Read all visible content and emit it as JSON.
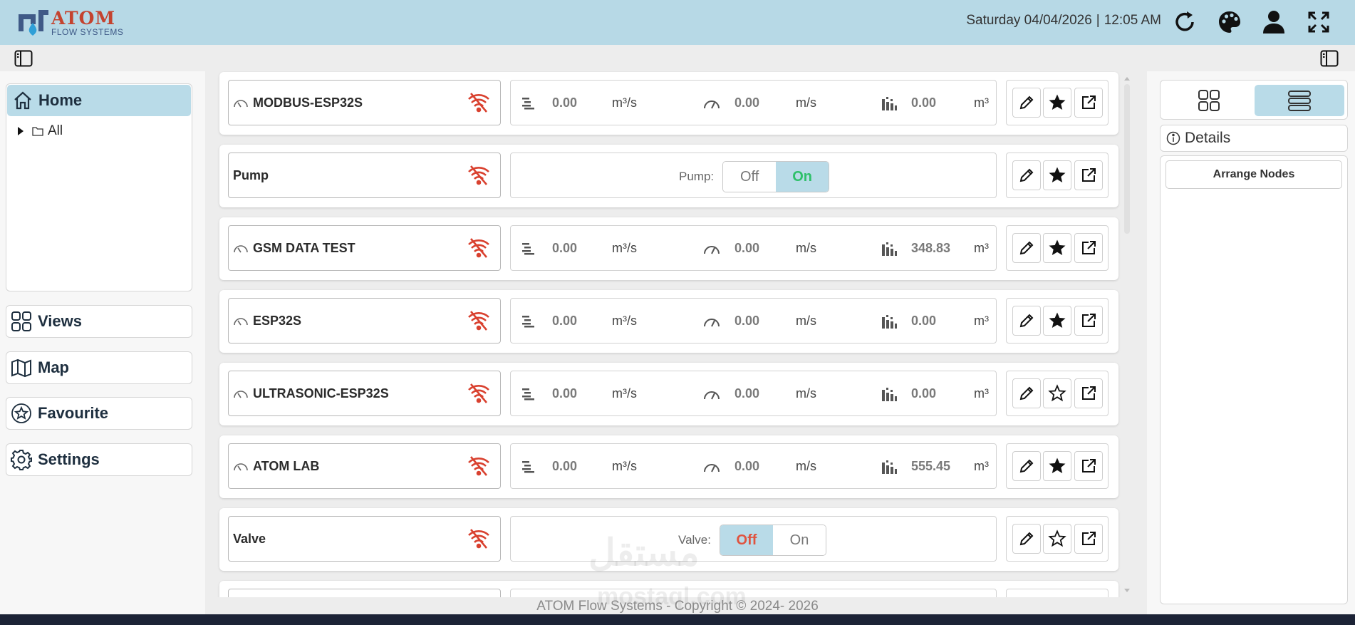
{
  "header": {
    "brand_title": "ATOM",
    "brand_subtitle": "FLOW SYSTEMS",
    "date": "Saturday 04/04/2026",
    "separator": "|",
    "time": "12:05 AM",
    "icons": [
      "refresh-icon",
      "palette-icon",
      "user-icon",
      "fullscreen-icon"
    ]
  },
  "sidebar": {
    "home_label": "Home",
    "tree_root": "All",
    "nav": [
      {
        "label": "Views",
        "icon": "views-grid-icon"
      },
      {
        "label": "Map",
        "icon": "map-icon"
      },
      {
        "label": "Favourite",
        "icon": "star-circle-icon"
      },
      {
        "label": "Settings",
        "icon": "gear-icon"
      }
    ]
  },
  "devices": [
    {
      "name": "MODBUS-ESP32S",
      "type": "meter",
      "gauge_icon": true,
      "flow": "0.00",
      "flow_unit": "m³/s",
      "velocity": "0.00",
      "velocity_unit": "m/s",
      "total": "0.00",
      "total_unit": "m³",
      "favourite": true
    },
    {
      "name": "Pump",
      "type": "toggle",
      "gauge_icon": false,
      "toggle_label": "Pump:",
      "off_label": "Off",
      "on_label": "On",
      "state": "on",
      "favourite": true
    },
    {
      "name": "GSM DATA TEST",
      "type": "meter",
      "gauge_icon": true,
      "flow": "0.00",
      "flow_unit": "m³/s",
      "velocity": "0.00",
      "velocity_unit": "m/s",
      "total": "348.83",
      "total_unit": "m³",
      "favourite": true
    },
    {
      "name": "ESP32S",
      "type": "meter",
      "gauge_icon": true,
      "flow": "0.00",
      "flow_unit": "m³/s",
      "velocity": "0.00",
      "velocity_unit": "m/s",
      "total": "0.00",
      "total_unit": "m³",
      "favourite": true
    },
    {
      "name": "ULTRASONIC-ESP32S",
      "type": "meter",
      "gauge_icon": true,
      "flow": "0.00",
      "flow_unit": "m³/s",
      "velocity": "0.00",
      "velocity_unit": "m/s",
      "total": "0.00",
      "total_unit": "m³",
      "favourite": false
    },
    {
      "name": "ATOM LAB",
      "type": "meter",
      "gauge_icon": true,
      "flow": "0.00",
      "flow_unit": "m³/s",
      "velocity": "0.00",
      "velocity_unit": "m/s",
      "total": "555.45",
      "total_unit": "m³",
      "favourite": true
    },
    {
      "name": "Valve",
      "type": "toggle",
      "gauge_icon": false,
      "toggle_label": "Valve:",
      "off_label": "Off",
      "on_label": "On",
      "state": "off",
      "favourite": false
    }
  ],
  "right_panel": {
    "details_label": "Details",
    "arrange_label": "Arrange Nodes",
    "active_view": "list"
  },
  "footer": {
    "copyright": "ATOM Flow Systems - Copyright © 2024- 2026",
    "watermark_ar": "مستقل",
    "watermark_en": "mostaql.com"
  },
  "colors": {
    "header_bg": "#b7d9e6",
    "accent": "#b9dbe8",
    "wifi_off": "#d9412f",
    "on_green": "#2ec06a",
    "off_red": "#e0533f"
  }
}
